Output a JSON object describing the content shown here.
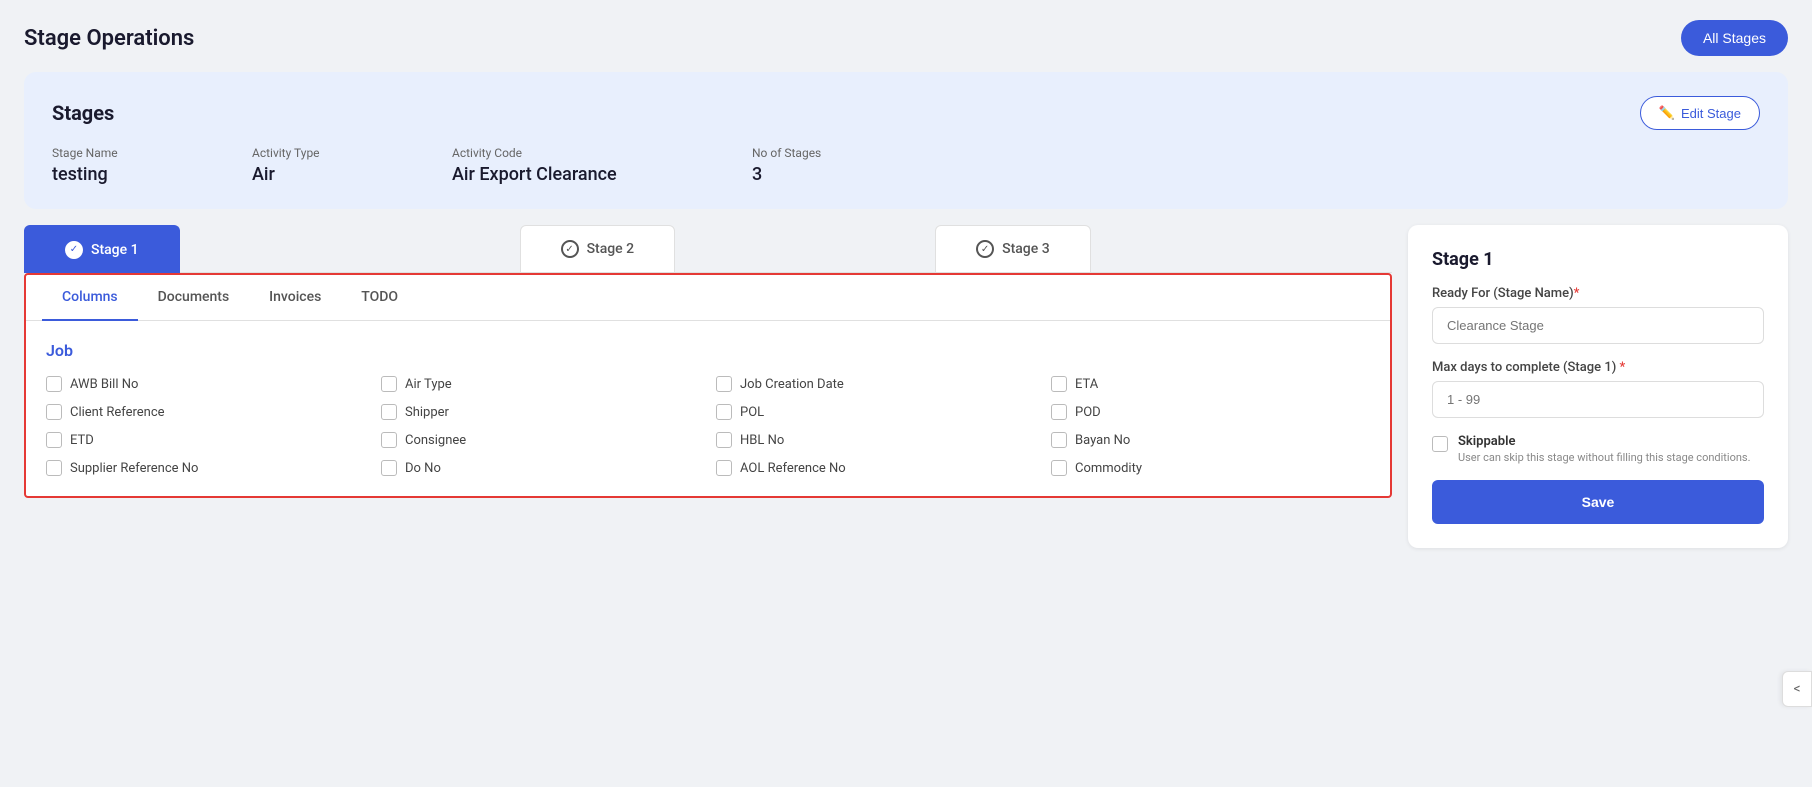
{
  "page": {
    "title": "Stage Operations",
    "all_stages_label": "All Stages"
  },
  "stages_card": {
    "title": "Stages",
    "edit_label": "Edit Stage",
    "stage_name_label": "Stage Name",
    "stage_name_value": "testing",
    "activity_type_label": "Activity Type",
    "activity_type_value": "Air",
    "activity_code_label": "Activity Code",
    "activity_code_value": "Air Export Clearance",
    "no_of_stages_label": "No of Stages",
    "no_of_stages_value": "3"
  },
  "stage_tabs": [
    {
      "label": "Stage 1",
      "active": true
    },
    {
      "label": "Stage 2",
      "active": false
    },
    {
      "label": "Stage 3",
      "active": false
    }
  ],
  "content_tabs": [
    {
      "label": "Columns",
      "active": true
    },
    {
      "label": "Documents",
      "active": false
    },
    {
      "label": "Invoices",
      "active": false
    },
    {
      "label": "TODO",
      "active": false
    }
  ],
  "columns_section": {
    "job_label": "Job",
    "items": [
      "AWB Bill No",
      "Air Type",
      "Job Creation Date",
      "ETA",
      "Client Reference",
      "Shipper",
      "POL",
      "POD",
      "ETD",
      "Consignee",
      "HBL No",
      "Bayan No",
      "Supplier Reference No",
      "Do No",
      "AOL Reference No",
      "Commodity"
    ]
  },
  "right_panel": {
    "title": "Stage 1",
    "ready_for_label": "Ready For (Stage Name)",
    "ready_for_placeholder": "Clearance Stage",
    "max_days_label": "Max days to complete (Stage 1)",
    "max_days_placeholder": "1 - 99",
    "skippable_title": "Skippable",
    "skippable_desc": "User can skip this stage without filling this stage conditions.",
    "save_label": "Save"
  },
  "collapse_icon": "<"
}
